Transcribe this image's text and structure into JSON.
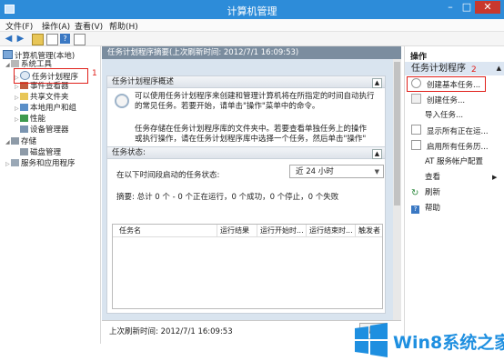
{
  "window": {
    "title": "计算机管理"
  },
  "menu": [
    "文件(F)",
    "操作(A)",
    "查看(V)",
    "帮助(H)"
  ],
  "tree": {
    "root": "计算机管理(本地)",
    "system_tools": "系统工具",
    "task_scheduler": "任务计划程序",
    "event_viewer": "事件查看器",
    "shared_folders": "共享文件夹",
    "local_users": "本地用户和组",
    "performance": "性能",
    "device_manager": "设备管理器",
    "storage": "存储",
    "disk_management": "磁盘管理",
    "services_apps": "服务和应用程序"
  },
  "annotations": {
    "one": "1",
    "two": "2"
  },
  "main": {
    "header": "任务计划程序摘要(上次刷新时间: 2012/7/1 16:09:53)",
    "overview_title": "任务计划程序概述",
    "overview_text1": "可以使用任务计划程序来创建和管理计算机将在所指定的时间自动执行的常见任务。若要开始，请单击\"操作\"菜单中的命令。",
    "overview_text2": "任务存储在任务计划程序库的文件夹中。若要查看单独任务上的操作",
    "overview_text3": "或执行操作，请在任务计划程序库中选择一个任务，然后单击\"操作\"",
    "status_title": "任务状态:",
    "status_label": "在以下时间段启动的任务状态:",
    "status_range": "近 24 小时",
    "summary": "摘要: 总计 0 个 - 0 个正在运行，0 个成功，0 个停止，0 个失败",
    "columns": [
      "任务名",
      "运行结果",
      "运行开始时...",
      "运行结束时...",
      "触发者"
    ],
    "refresh_time": "上次刷新时间: 2012/7/1 16:09:53",
    "refresh_btn": "刷"
  },
  "actions": {
    "header": "操作",
    "section": "任务计划程序",
    "items": [
      "创建基本任务...",
      "创建任务...",
      "导入任务...",
      "显示所有正在运...",
      "启用所有任务历...",
      "AT 服务帐户配置",
      "查看",
      "刷新",
      "帮助"
    ]
  },
  "watermark": {
    "text": "Win8系统之家"
  }
}
